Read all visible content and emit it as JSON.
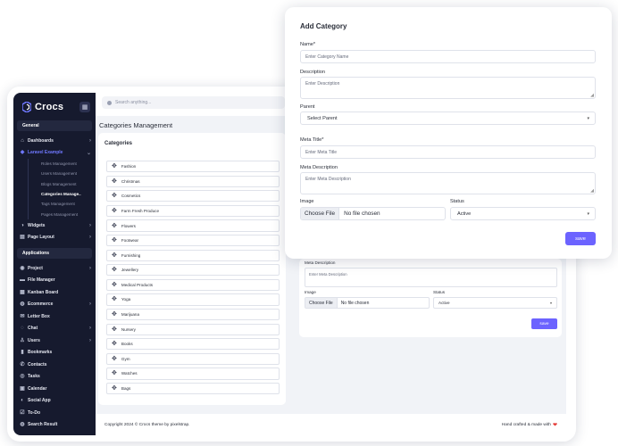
{
  "app": {
    "brand": "Crocs",
    "search_placeholder": "Search anything...",
    "page_title": "Categories Management"
  },
  "sidebar": {
    "sections": [
      {
        "title": "General"
      },
      {
        "title": "Applications"
      }
    ],
    "general_items": [
      {
        "label": "Dashboards",
        "icon": "home-icon",
        "glyph": "⌂",
        "chevron": "›"
      },
      {
        "label": "Laravel Example",
        "icon": "laravel-icon",
        "glyph": "◆",
        "chevron": "⌄",
        "active": true
      }
    ],
    "sub_items": [
      {
        "label": "Roles Management"
      },
      {
        "label": "Users Management"
      },
      {
        "label": "Blogs Management"
      },
      {
        "label": "Categories Manage..",
        "current": true
      },
      {
        "label": "Tags Management"
      },
      {
        "label": "Pages Management"
      }
    ],
    "general_items_after": [
      {
        "label": "Widgets",
        "icon": "widgets-icon",
        "glyph": "◑",
        "chevron": "›"
      },
      {
        "label": "Page Layout",
        "icon": "layout-icon",
        "glyph": "▤",
        "chevron": "›"
      }
    ],
    "app_items": [
      {
        "label": "Project",
        "icon": "project-icon",
        "glyph": "◉",
        "chevron": "›"
      },
      {
        "label": "File Manager",
        "icon": "folder-icon",
        "glyph": "▬",
        "chevron": ""
      },
      {
        "label": "Kanban Board",
        "icon": "kanban-icon",
        "glyph": "▦",
        "chevron": ""
      },
      {
        "label": "Ecommerce",
        "icon": "cart-icon",
        "glyph": "◍",
        "chevron": "›"
      },
      {
        "label": "Letter Box",
        "icon": "mail-icon",
        "glyph": "✉",
        "chevron": ""
      },
      {
        "label": "Chat",
        "icon": "chat-icon",
        "glyph": "◌",
        "chevron": "›"
      },
      {
        "label": "Users",
        "icon": "user-icon",
        "glyph": "♙",
        "chevron": "›"
      },
      {
        "label": "Bookmarks",
        "icon": "bookmark-icon",
        "glyph": "▮",
        "chevron": ""
      },
      {
        "label": "Contacts",
        "icon": "phone-icon",
        "glyph": "✆",
        "chevron": ""
      },
      {
        "label": "Tasks",
        "icon": "tasks-icon",
        "glyph": "◎",
        "chevron": ""
      },
      {
        "label": "Calendar",
        "icon": "calendar-icon",
        "glyph": "▣",
        "chevron": ""
      },
      {
        "label": "Social App",
        "icon": "social-icon",
        "glyph": "◐",
        "chevron": ""
      },
      {
        "label": "To-Do",
        "icon": "todo-icon",
        "glyph": "☑",
        "chevron": ""
      },
      {
        "label": "Search Result",
        "icon": "search-result-icon",
        "glyph": "◍",
        "chevron": ""
      }
    ]
  },
  "categories_card": {
    "title": "Categories",
    "items": [
      "Fashion",
      "Christmas",
      "Cosmetics",
      "Farm Fresh Produce",
      "Flowers",
      "Footwear",
      "Furnishing",
      "Jewellery",
      "Medical Products",
      "Yoga",
      "Marijuana",
      "Nursery",
      "Books",
      "Gym",
      "Watches",
      "Bags"
    ]
  },
  "background_form": {
    "meta_description_label": "Meta Description",
    "meta_description_placeholder": "Enter Meta Description",
    "image_label": "Image",
    "file_button": "Choose File",
    "file_status": "No file chosen",
    "status_label": "Status",
    "status_value": "Active",
    "save_label": "save"
  },
  "footer": {
    "copyright": "Copyright 2024 © Crocs theme by pixelstrap.",
    "crafted": "Hand crafted & made with",
    "heart": "❤"
  },
  "modal": {
    "title": "Add Category",
    "name_label": "Name*",
    "name_placeholder": "Enter Category Name",
    "description_label": "Description",
    "description_placeholder": "Enter Description",
    "parent_label": "Parent",
    "parent_value": "Select Parent",
    "meta_title_label": "Meta Title*",
    "meta_title_placeholder": "Enter Meta Title",
    "meta_description_label": "Meta Description",
    "meta_description_placeholder": "Enter Meta Description",
    "image_label": "Image",
    "file_button": "Choose File",
    "file_status": "No file chosen",
    "status_label": "Status",
    "status_value": "Active",
    "save_label": "save"
  },
  "colors": {
    "sidebar_bg": "#161a2e",
    "accent": "#6c63ff",
    "active_nav": "#6f78ff",
    "content_bg": "#f1f3f7",
    "heart": "#e53935"
  }
}
